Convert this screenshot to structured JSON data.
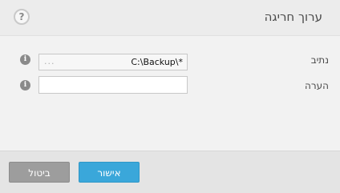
{
  "dialog": {
    "title": "ערוך חריגה",
    "help_glyph": "?"
  },
  "form": {
    "path": {
      "label": "נתיב",
      "value": "C:\\Backup\\*",
      "browse_glyph": "...",
      "info_glyph": "i"
    },
    "comment": {
      "label": "הערה",
      "value": "",
      "placeholder": "",
      "info_glyph": "i"
    }
  },
  "buttons": {
    "ok_label": "אישור",
    "cancel_label": "ביטול"
  },
  "colors": {
    "ok_button": "#3aa7da",
    "cancel_button": "#9d9d9d",
    "header_bg": "#ececec",
    "footer_bg": "#e4e4e4"
  },
  "icons": {
    "help": "help-icon",
    "info": "info-icon"
  }
}
